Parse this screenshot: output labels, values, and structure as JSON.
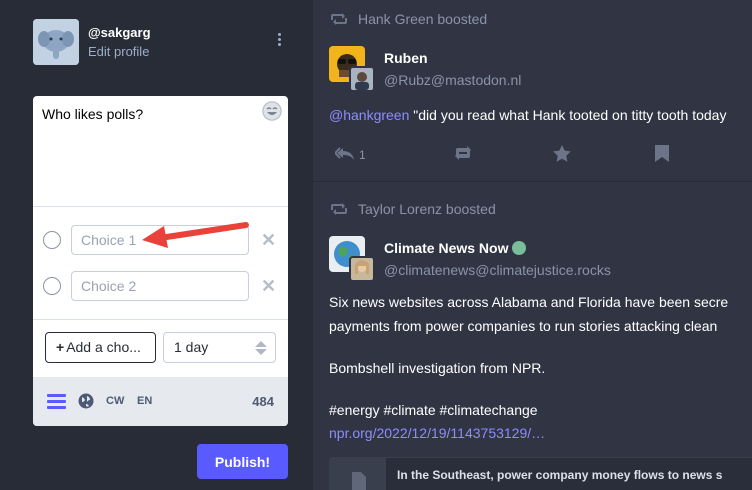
{
  "compose": {
    "profile": {
      "handle": "@sakgarg",
      "edit_label": "Edit profile"
    },
    "text": "Who likes polls?",
    "poll": {
      "choices": [
        {
          "placeholder": "Choice 1"
        },
        {
          "placeholder": "Choice 2"
        }
      ],
      "add_choice_label": "Add a cho...",
      "duration": "1 day"
    },
    "toolbar": {
      "cw_label": "CW",
      "lang_label": "EN",
      "char_count": "484"
    },
    "publish_label": "Publish!"
  },
  "timeline": {
    "statuses": [
      {
        "boosted_by": "Hank Green boosted",
        "display_name": "Ruben",
        "acct": "@Rubz@mastodon.nl",
        "mention": "@hankgreen",
        "content": " \"did you read what Hank tooted on titty tooth today",
        "reply_count": "1"
      },
      {
        "boosted_by": "Taylor Lorenz boosted",
        "display_name": "Climate News Now",
        "acct": "@climatenews@climatejustice.rocks",
        "lines": [
          "Six news websites across Alabama and Florida have been secre",
          "payments from power companies to run stories attacking clean",
          "Bombshell investigation from NPR.",
          "#energy #climate #climatechange"
        ],
        "link": "npr.org/2022/12/19/1143753129/…",
        "card_title": "In the Southeast, power company money flows to news s"
      }
    ]
  },
  "colors": {
    "background": "#282c37",
    "timeline_bg": "#313543",
    "accent": "#595aff",
    "link": "#8c8dff",
    "annotation_arrow": "#e8423a"
  }
}
